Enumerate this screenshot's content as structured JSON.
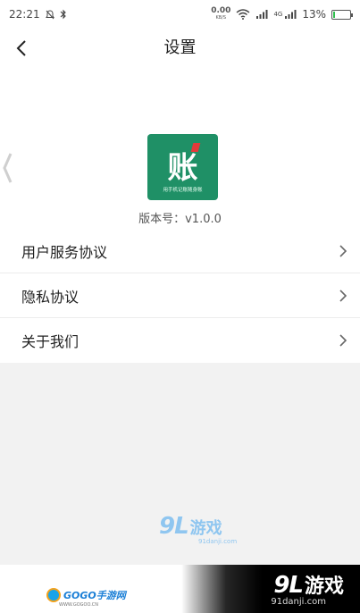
{
  "status_bar": {
    "time": "22:21",
    "speed_top": "0.00",
    "speed_bottom": "KB/S",
    "signal_label": "4G",
    "battery_percent": "13%",
    "battery_level": 0.13,
    "battery_color": "#2fbf4d",
    "icons": [
      "no-notification-icon",
      "bluetooth-icon",
      "wifi-icon",
      "signal-icon",
      "battery-icon"
    ]
  },
  "nav": {
    "title": "设置",
    "back_icon": "chevron-left-icon"
  },
  "app": {
    "logo_text": "账",
    "logo_subtitle": "用手机记账随身账",
    "logo_color": "#1f9066",
    "version": "版本号：v1.0.0"
  },
  "menu": {
    "items": [
      {
        "label": "用户服务协议",
        "icon": "chevron-right-icon"
      },
      {
        "label": "隐私协议",
        "icon": "chevron-right-icon"
      },
      {
        "label": "关于我们",
        "icon": "chevron-right-icon"
      }
    ]
  },
  "watermarks": {
    "center_logo": "9L",
    "center_text": "游戏",
    "center_url": "91danji.com",
    "footer_left": "GOGO手游网",
    "footer_left_url": "WWW.GOGOO.CN",
    "footer_right_logo": "9L",
    "footer_right_text": "游戏",
    "footer_right_url": "91danji.com"
  }
}
